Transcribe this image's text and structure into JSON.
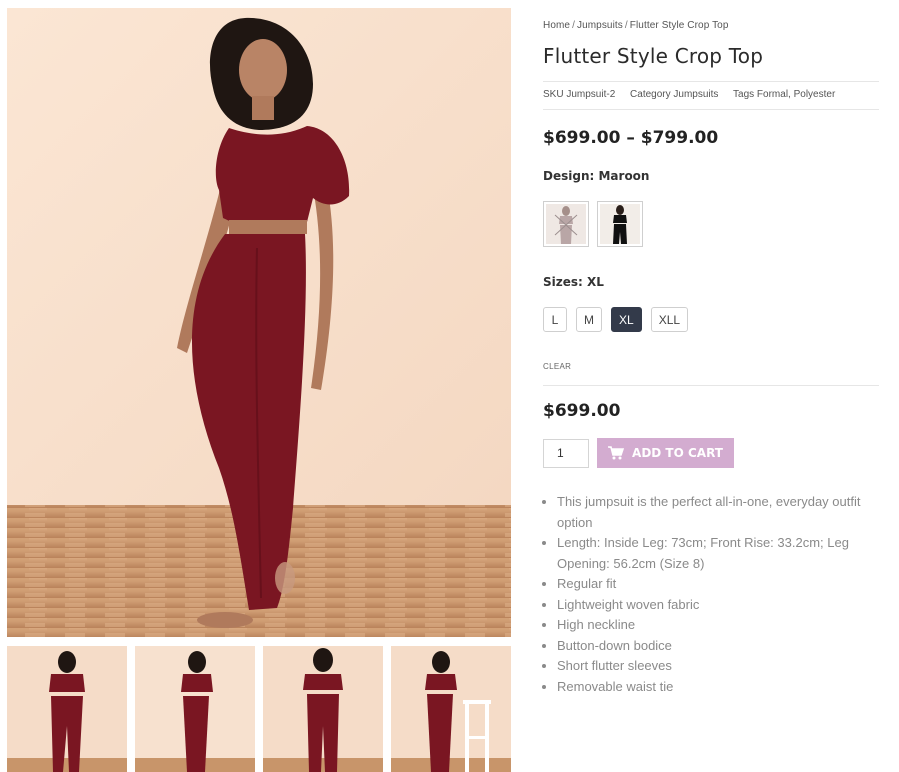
{
  "breadcrumb": {
    "items": [
      "Home",
      "Jumpsuits",
      "Flutter Style Crop Top"
    ],
    "separator": "/"
  },
  "product": {
    "title": "Flutter Style Crop Top",
    "sku_label": "SKU",
    "sku": "Jumpsuit-2",
    "category_label": "Category",
    "category": "Jumpsuits",
    "tags_label": "Tags",
    "tags": "Formal, Polyester",
    "price_range": "$699.00 – $799.00",
    "price": "$699.00"
  },
  "design": {
    "label": "Design:",
    "value": "Maroon",
    "swatches": [
      {
        "name": "maroon",
        "icon": "outfit-maroon-thumb",
        "disabled": true
      },
      {
        "name": "black",
        "icon": "outfit-black-thumb",
        "disabled": false
      }
    ]
  },
  "sizes": {
    "label": "Sizes:",
    "value": "XL",
    "options": [
      "L",
      "M",
      "XL",
      "XLL"
    ],
    "selected": "XL"
  },
  "clear_label": "CLEAR",
  "cart": {
    "quantity": "1",
    "button_label": "ADD TO CART",
    "button_icon": "cart-icon",
    "button_color": "#d3acd0"
  },
  "features": [
    "This jumpsuit is the perfect all-in-one, everyday outfit option",
    "Length: Inside Leg: 73cm; Front Rise: 33.2cm; Leg Opening: 56.2cm (Size 8)",
    "Regular fit",
    "Lightweight woven fabric",
    "High neckline",
    "Button-down bodice",
    "Short flutter sleeves",
    "Removable waist tie"
  ],
  "colors": {
    "garment": "#7a1622",
    "backdrop": "#f6dfcc",
    "floor": "#c8956a",
    "selected_size_bg": "#333a4a"
  }
}
